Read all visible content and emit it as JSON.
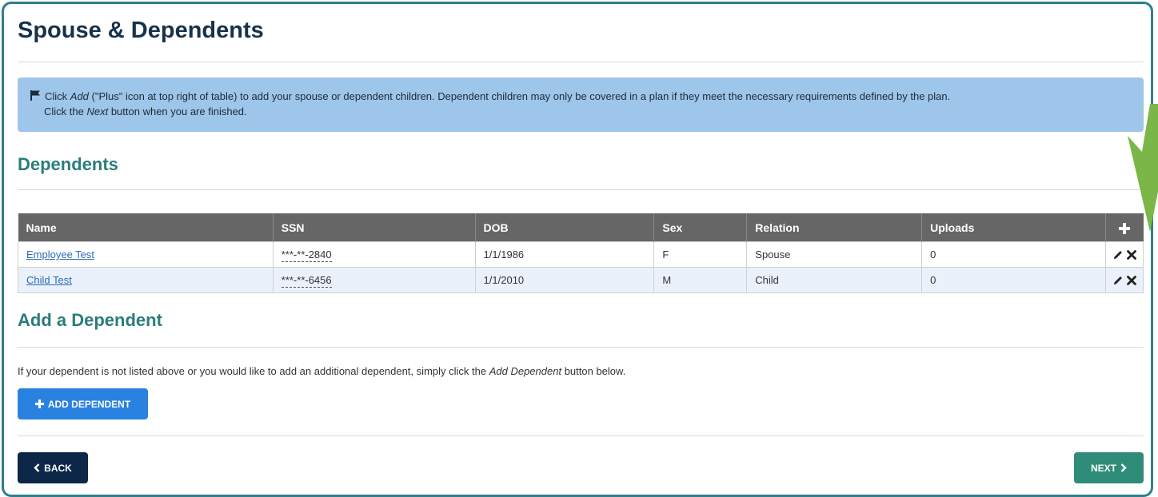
{
  "page": {
    "title": "Spouse & Dependents"
  },
  "info": {
    "line1_a": "Click ",
    "line1_add": "Add",
    "line1_b": " (\"Plus\" icon at top right of table) to add your spouse or dependent children. Dependent children may only be covered in a plan if they meet the necessary requirements defined by the plan.",
    "line2_a": "Click the ",
    "line2_next": "Next",
    "line2_b": " button when you are finished."
  },
  "dependents": {
    "title": "Dependents",
    "columns": [
      "Name",
      "SSN",
      "DOB",
      "Sex",
      "Relation",
      "Uploads"
    ],
    "rows": [
      {
        "name": "Employee Test",
        "ssn": "***-**-2840",
        "dob": "1/1/1986",
        "sex": "F",
        "relation": "Spouse",
        "uploads": "0"
      },
      {
        "name": "Child Test",
        "ssn": "***-**-6456",
        "dob": "1/1/2010",
        "sex": "M",
        "relation": "Child",
        "uploads": "0"
      }
    ]
  },
  "add_section": {
    "title": "Add a Dependent",
    "text_a": "If your dependent is not listed above or you would like to add an additional dependent, simply click the ",
    "text_em": "Add Dependent",
    "text_b": " button below.",
    "button_label": "ADD DEPENDENT"
  },
  "nav": {
    "back_label": "BACK",
    "next_label": "NEXT"
  },
  "colors": {
    "title": "#17324a",
    "section_title": "#2b7d7a",
    "info_bg": "#9ec5ea",
    "table_header": "#666666",
    "add_button": "#2a82e0",
    "back_button": "#0c2747",
    "next_button": "#2e8c78",
    "annotation_arrow": "#7ab648",
    "frame": "#2e7f8c"
  },
  "icons": {
    "info": "flag-icon",
    "table_add": "plus-icon",
    "edit": "pencil-icon",
    "delete": "x-icon",
    "back": "chevron-left-icon",
    "next": "chevron-right-icon",
    "annotation": "arrow-icon"
  }
}
